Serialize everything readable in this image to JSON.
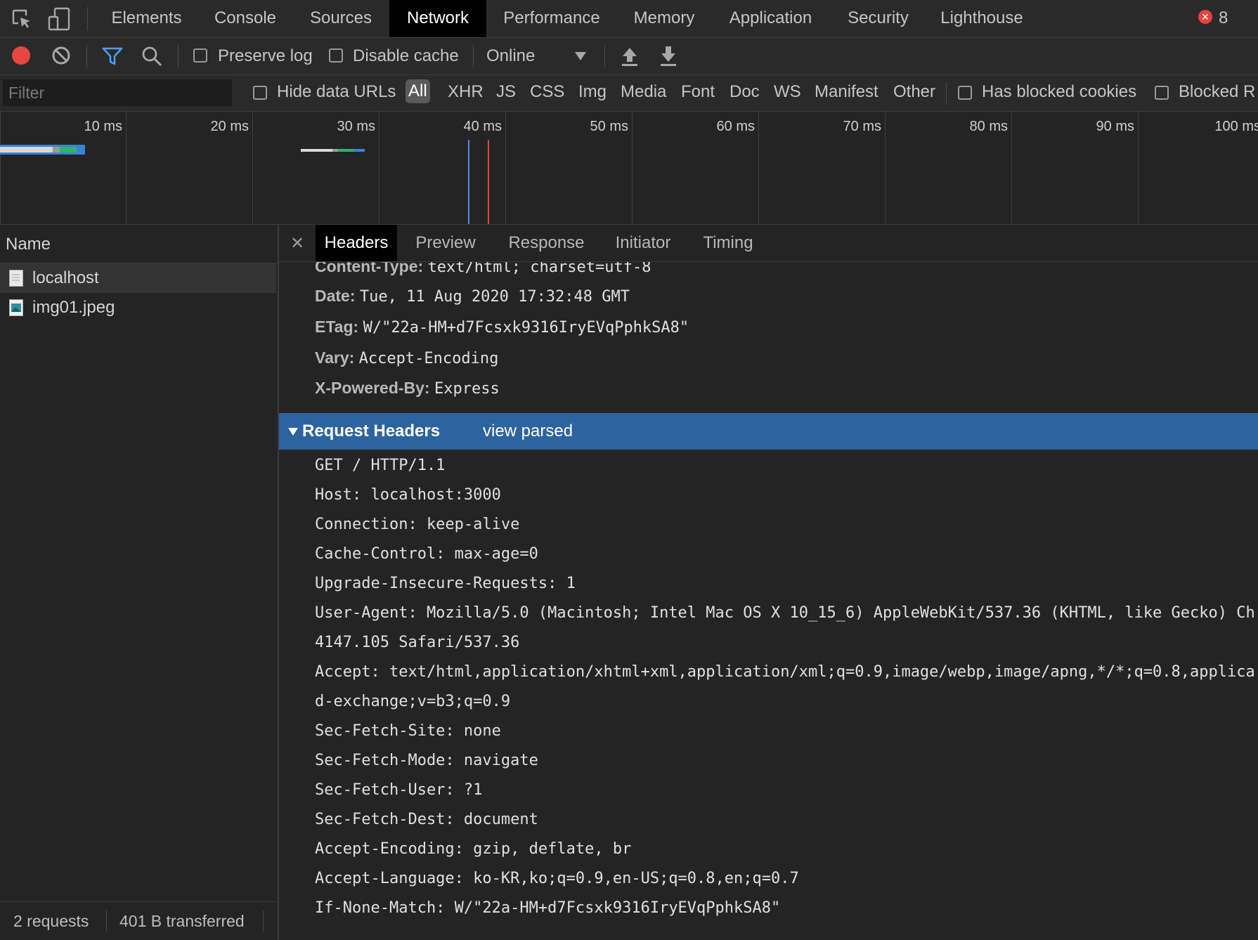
{
  "tabs": [
    "Elements",
    "Console",
    "Sources",
    "Network",
    "Performance",
    "Memory",
    "Application",
    "Security",
    "Lighthouse"
  ],
  "active_tab": "Network",
  "error_count": "8",
  "toolbar": {
    "preserve_log": "Preserve log",
    "disable_cache": "Disable cache",
    "throttling": "Online"
  },
  "filter": {
    "placeholder": "Filter",
    "hide_data_urls": "Hide data URLs",
    "types": [
      "All",
      "XHR",
      "JS",
      "CSS",
      "Img",
      "Media",
      "Font",
      "Doc",
      "WS",
      "Manifest",
      "Other"
    ],
    "active_type": "All",
    "has_blocked_cookies": "Has blocked cookies",
    "blocked_requests": "Blocked R"
  },
  "timeline": {
    "ticks": [
      "10 ms",
      "20 ms",
      "30 ms",
      "40 ms",
      "50 ms",
      "60 ms",
      "70 ms",
      "80 ms",
      "90 ms",
      "100 ms"
    ]
  },
  "name_pane": {
    "header": "Name",
    "requests": [
      "localhost",
      "img01.jpeg"
    ],
    "status_requests": "2 requests",
    "status_transferred": "401 B transferred"
  },
  "detail_tabs": [
    "Headers",
    "Preview",
    "Response",
    "Initiator",
    "Timing"
  ],
  "active_detail_tab": "Headers",
  "response_headers": [
    {
      "name": "Content-Type:",
      "value": "text/html; charset=utf-8"
    },
    {
      "name": "Date:",
      "value": "Tue, 11 Aug 2020 17:32:48 GMT"
    },
    {
      "name": "ETag:",
      "value": "W/\"22a-HM+d7Fcsxk9316IryEVqPphkSA8\""
    },
    {
      "name": "Vary:",
      "value": "Accept-Encoding"
    },
    {
      "name": "X-Powered-By:",
      "value": "Express"
    }
  ],
  "request_section": {
    "title": "Request Headers",
    "toggle": "view parsed"
  },
  "request_lines": [
    "GET / HTTP/1.1",
    "Host: localhost:3000",
    "Connection: keep-alive",
    "Cache-Control: max-age=0",
    "Upgrade-Insecure-Requests: 1",
    "User-Agent: Mozilla/5.0 (Macintosh; Intel Mac OS X 10_15_6) AppleWebKit/537.36 (KHTML, like Gecko) Ch",
    "4147.105 Safari/537.36",
    "Accept: text/html,application/xhtml+xml,application/xml;q=0.9,image/webp,image/apng,*/*;q=0.8,applica",
    "d-exchange;v=b3;q=0.9",
    "Sec-Fetch-Site: none",
    "Sec-Fetch-Mode: navigate",
    "Sec-Fetch-User: ?1",
    "Sec-Fetch-Dest: document",
    "Accept-Encoding: gzip, deflate, br",
    "Accept-Language: ko-KR,ko;q=0.9,en-US;q=0.8,en;q=0.7",
    "If-None-Match: W/\"22a-HM+d7Fcsxk9316IryEVqPphkSA8\""
  ]
}
